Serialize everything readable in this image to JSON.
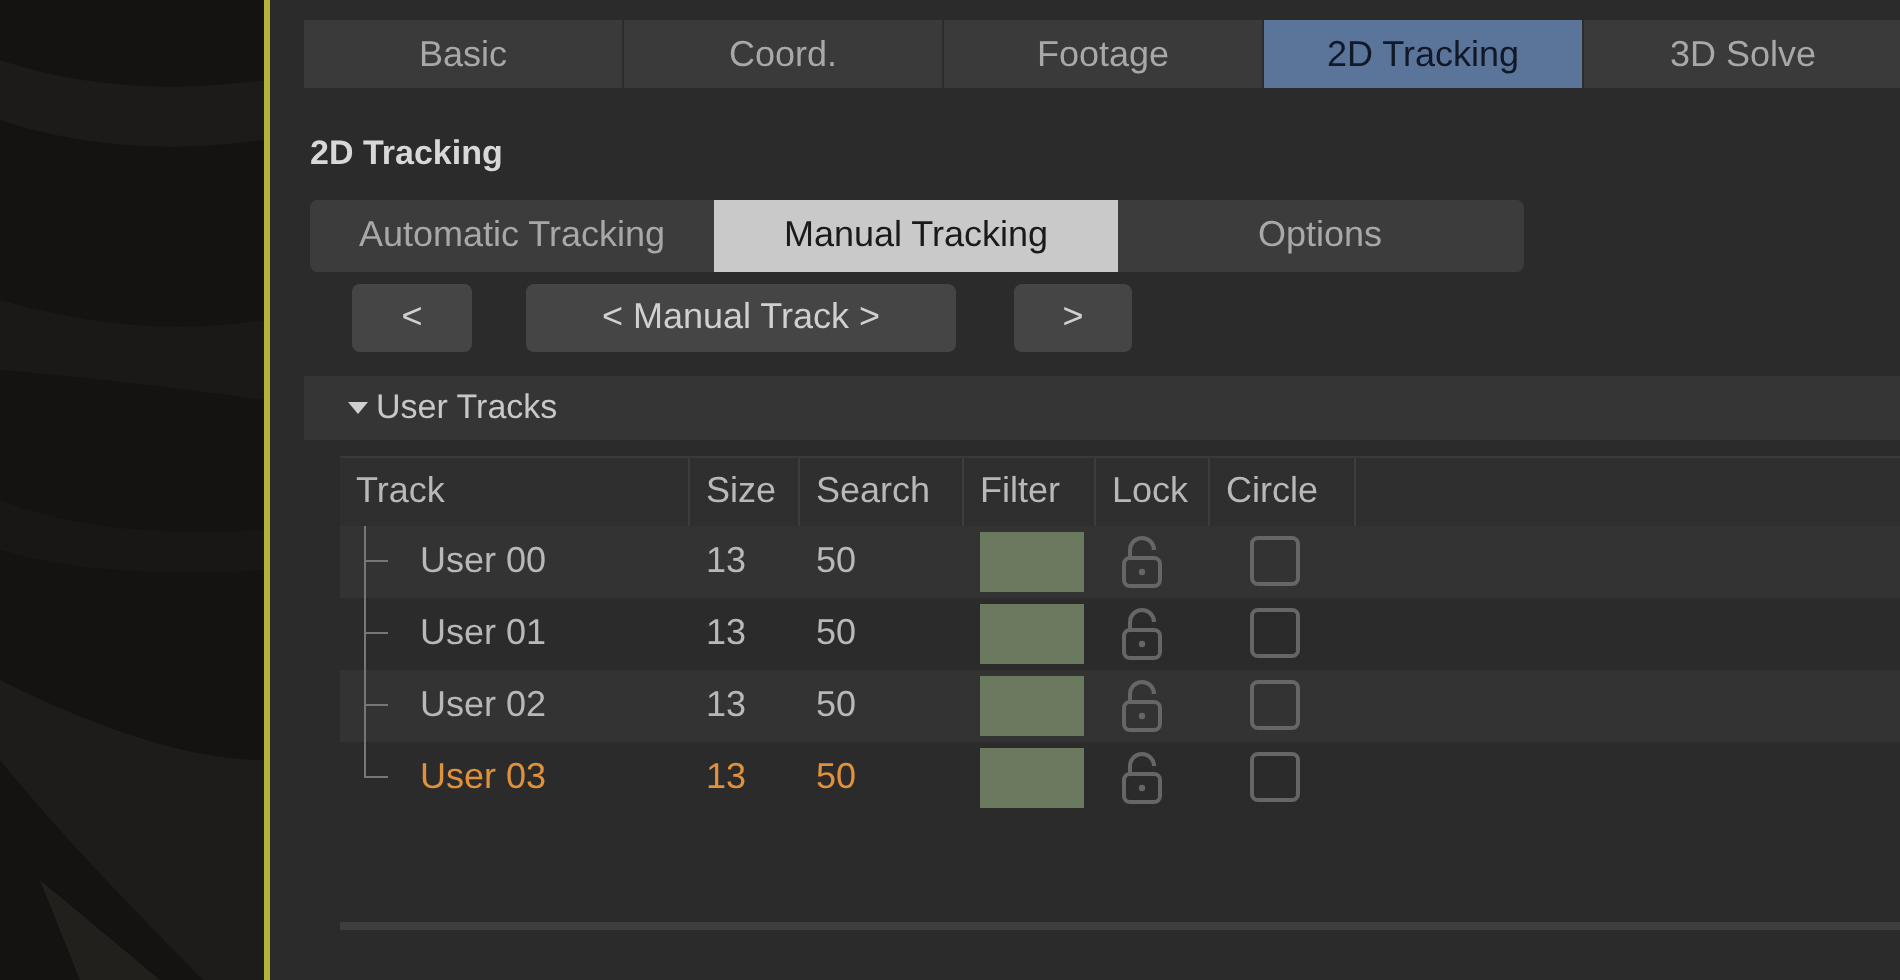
{
  "tabs": [
    {
      "label": "Basic",
      "selected": false
    },
    {
      "label": "Coord.",
      "selected": false
    },
    {
      "label": "Footage",
      "selected": false
    },
    {
      "label": "2D Tracking",
      "selected": true
    },
    {
      "label": "3D Solve",
      "selected": false
    }
  ],
  "section_title": "2D Tracking",
  "subtabs": [
    {
      "label": "Automatic Tracking",
      "selected": false
    },
    {
      "label": "Manual Tracking",
      "selected": true
    },
    {
      "label": "Options",
      "selected": false
    }
  ],
  "nav_buttons": [
    "<",
    "< Manual Track >",
    ">"
  ],
  "group": {
    "title": "User Tracks",
    "expanded": true
  },
  "table": {
    "columns": [
      "Track",
      "Size",
      "Search",
      "Filter",
      "Lock",
      "Circle"
    ],
    "rows": [
      {
        "track": "User 00",
        "size": "13",
        "search": "50",
        "color": "#6b7a5e",
        "locked": false,
        "circle": false,
        "selected": false
      },
      {
        "track": "User 01",
        "size": "13",
        "search": "50",
        "color": "#6b7a5e",
        "locked": false,
        "circle": false,
        "selected": false
      },
      {
        "track": "User 02",
        "size": "13",
        "search": "50",
        "color": "#6b7a5e",
        "locked": false,
        "circle": false,
        "selected": false
      },
      {
        "track": "User 03",
        "size": "13",
        "search": "50",
        "color": "#6b7a5e",
        "locked": false,
        "circle": false,
        "selected": true
      }
    ]
  }
}
